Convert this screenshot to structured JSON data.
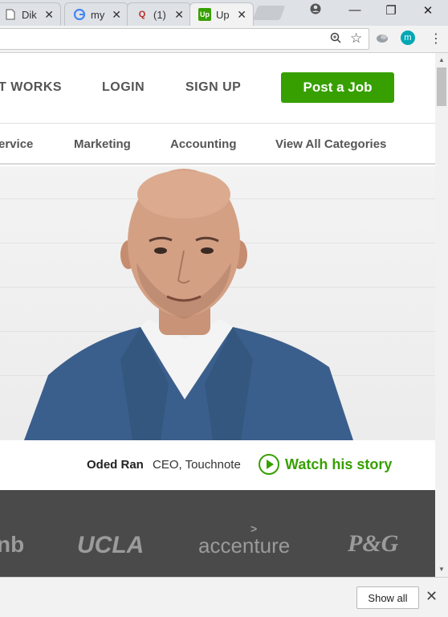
{
  "browser": {
    "tabs": [
      {
        "title": "Dik",
        "icon": "document-icon"
      },
      {
        "title": "my",
        "icon": "google-icon"
      },
      {
        "title": "(1)",
        "icon": "quora-icon"
      },
      {
        "title": "Up",
        "icon": "upwork-icon"
      }
    ],
    "profile_initial": "m"
  },
  "nav": {
    "how_it_works": "T WORKS",
    "login": "LOGIN",
    "sign_up": "SIGN UP",
    "post_job": "Post a Job"
  },
  "categories": {
    "service": "ervice",
    "marketing": "Marketing",
    "accounting": "Accounting",
    "view_all": "View All Categories"
  },
  "hero": {
    "name": "Oded Ran",
    "role": "CEO, Touchnote",
    "watch": "Watch his story"
  },
  "logos": {
    "partial": "nb",
    "ucla": "UCLA",
    "accenture": "accenture",
    "pg": "P&G"
  },
  "download_bar": {
    "show_all": "Show all"
  },
  "colors": {
    "accent_green": "#37a000",
    "logo_bar": "#4a4a4a"
  }
}
